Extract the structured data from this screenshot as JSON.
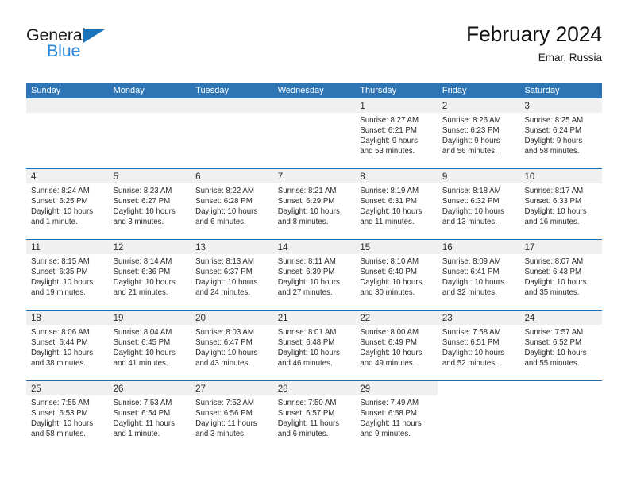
{
  "brand": {
    "name_top": "General",
    "name_bottom": "Blue",
    "accent_color": "#1a74bb",
    "logo_icon": "triangle-icon"
  },
  "header": {
    "title": "February 2024",
    "location": "Emar, Russia"
  },
  "colors": {
    "header_blue": "#2e75b6",
    "row_divider": "#1f6eb5",
    "day_number_bar": "#f0f0f0",
    "text": "#2b2b2b"
  },
  "weekday_headers": [
    "Sunday",
    "Monday",
    "Tuesday",
    "Wednesday",
    "Thursday",
    "Friday",
    "Saturday"
  ],
  "weeks": [
    [
      {
        "day": "",
        "sunrise": "",
        "sunset": "",
        "daylight_line1": "",
        "daylight_line2": "",
        "kind": "empty"
      },
      {
        "day": "",
        "sunrise": "",
        "sunset": "",
        "daylight_line1": "",
        "daylight_line2": "",
        "kind": "empty"
      },
      {
        "day": "",
        "sunrise": "",
        "sunset": "",
        "daylight_line1": "",
        "daylight_line2": "",
        "kind": "empty"
      },
      {
        "day": "",
        "sunrise": "",
        "sunset": "",
        "daylight_line1": "",
        "daylight_line2": "",
        "kind": "empty"
      },
      {
        "day": "1",
        "sunrise": "Sunrise: 8:27 AM",
        "sunset": "Sunset: 6:21 PM",
        "daylight_line1": "Daylight: 9 hours",
        "daylight_line2": "and 53 minutes.",
        "kind": "day"
      },
      {
        "day": "2",
        "sunrise": "Sunrise: 8:26 AM",
        "sunset": "Sunset: 6:23 PM",
        "daylight_line1": "Daylight: 9 hours",
        "daylight_line2": "and 56 minutes.",
        "kind": "day"
      },
      {
        "day": "3",
        "sunrise": "Sunrise: 8:25 AM",
        "sunset": "Sunset: 6:24 PM",
        "daylight_line1": "Daylight: 9 hours",
        "daylight_line2": "and 58 minutes.",
        "kind": "day"
      }
    ],
    [
      {
        "day": "4",
        "sunrise": "Sunrise: 8:24 AM",
        "sunset": "Sunset: 6:25 PM",
        "daylight_line1": "Daylight: 10 hours",
        "daylight_line2": "and 1 minute.",
        "kind": "day"
      },
      {
        "day": "5",
        "sunrise": "Sunrise: 8:23 AM",
        "sunset": "Sunset: 6:27 PM",
        "daylight_line1": "Daylight: 10 hours",
        "daylight_line2": "and 3 minutes.",
        "kind": "day"
      },
      {
        "day": "6",
        "sunrise": "Sunrise: 8:22 AM",
        "sunset": "Sunset: 6:28 PM",
        "daylight_line1": "Daylight: 10 hours",
        "daylight_line2": "and 6 minutes.",
        "kind": "day"
      },
      {
        "day": "7",
        "sunrise": "Sunrise: 8:21 AM",
        "sunset": "Sunset: 6:29 PM",
        "daylight_line1": "Daylight: 10 hours",
        "daylight_line2": "and 8 minutes.",
        "kind": "day"
      },
      {
        "day": "8",
        "sunrise": "Sunrise: 8:19 AM",
        "sunset": "Sunset: 6:31 PM",
        "daylight_line1": "Daylight: 10 hours",
        "daylight_line2": "and 11 minutes.",
        "kind": "day"
      },
      {
        "day": "9",
        "sunrise": "Sunrise: 8:18 AM",
        "sunset": "Sunset: 6:32 PM",
        "daylight_line1": "Daylight: 10 hours",
        "daylight_line2": "and 13 minutes.",
        "kind": "day"
      },
      {
        "day": "10",
        "sunrise": "Sunrise: 8:17 AM",
        "sunset": "Sunset: 6:33 PM",
        "daylight_line1": "Daylight: 10 hours",
        "daylight_line2": "and 16 minutes.",
        "kind": "day"
      }
    ],
    [
      {
        "day": "11",
        "sunrise": "Sunrise: 8:15 AM",
        "sunset": "Sunset: 6:35 PM",
        "daylight_line1": "Daylight: 10 hours",
        "daylight_line2": "and 19 minutes.",
        "kind": "day"
      },
      {
        "day": "12",
        "sunrise": "Sunrise: 8:14 AM",
        "sunset": "Sunset: 6:36 PM",
        "daylight_line1": "Daylight: 10 hours",
        "daylight_line2": "and 21 minutes.",
        "kind": "day"
      },
      {
        "day": "13",
        "sunrise": "Sunrise: 8:13 AM",
        "sunset": "Sunset: 6:37 PM",
        "daylight_line1": "Daylight: 10 hours",
        "daylight_line2": "and 24 minutes.",
        "kind": "day"
      },
      {
        "day": "14",
        "sunrise": "Sunrise: 8:11 AM",
        "sunset": "Sunset: 6:39 PM",
        "daylight_line1": "Daylight: 10 hours",
        "daylight_line2": "and 27 minutes.",
        "kind": "day"
      },
      {
        "day": "15",
        "sunrise": "Sunrise: 8:10 AM",
        "sunset": "Sunset: 6:40 PM",
        "daylight_line1": "Daylight: 10 hours",
        "daylight_line2": "and 30 minutes.",
        "kind": "day"
      },
      {
        "day": "16",
        "sunrise": "Sunrise: 8:09 AM",
        "sunset": "Sunset: 6:41 PM",
        "daylight_line1": "Daylight: 10 hours",
        "daylight_line2": "and 32 minutes.",
        "kind": "day"
      },
      {
        "day": "17",
        "sunrise": "Sunrise: 8:07 AM",
        "sunset": "Sunset: 6:43 PM",
        "daylight_line1": "Daylight: 10 hours",
        "daylight_line2": "and 35 minutes.",
        "kind": "day"
      }
    ],
    [
      {
        "day": "18",
        "sunrise": "Sunrise: 8:06 AM",
        "sunset": "Sunset: 6:44 PM",
        "daylight_line1": "Daylight: 10 hours",
        "daylight_line2": "and 38 minutes.",
        "kind": "day"
      },
      {
        "day": "19",
        "sunrise": "Sunrise: 8:04 AM",
        "sunset": "Sunset: 6:45 PM",
        "daylight_line1": "Daylight: 10 hours",
        "daylight_line2": "and 41 minutes.",
        "kind": "day"
      },
      {
        "day": "20",
        "sunrise": "Sunrise: 8:03 AM",
        "sunset": "Sunset: 6:47 PM",
        "daylight_line1": "Daylight: 10 hours",
        "daylight_line2": "and 43 minutes.",
        "kind": "day"
      },
      {
        "day": "21",
        "sunrise": "Sunrise: 8:01 AM",
        "sunset": "Sunset: 6:48 PM",
        "daylight_line1": "Daylight: 10 hours",
        "daylight_line2": "and 46 minutes.",
        "kind": "day"
      },
      {
        "day": "22",
        "sunrise": "Sunrise: 8:00 AM",
        "sunset": "Sunset: 6:49 PM",
        "daylight_line1": "Daylight: 10 hours",
        "daylight_line2": "and 49 minutes.",
        "kind": "day"
      },
      {
        "day": "23",
        "sunrise": "Sunrise: 7:58 AM",
        "sunset": "Sunset: 6:51 PM",
        "daylight_line1": "Daylight: 10 hours",
        "daylight_line2": "and 52 minutes.",
        "kind": "day"
      },
      {
        "day": "24",
        "sunrise": "Sunrise: 7:57 AM",
        "sunset": "Sunset: 6:52 PM",
        "daylight_line1": "Daylight: 10 hours",
        "daylight_line2": "and 55 minutes.",
        "kind": "day"
      }
    ],
    [
      {
        "day": "25",
        "sunrise": "Sunrise: 7:55 AM",
        "sunset": "Sunset: 6:53 PM",
        "daylight_line1": "Daylight: 10 hours",
        "daylight_line2": "and 58 minutes.",
        "kind": "day"
      },
      {
        "day": "26",
        "sunrise": "Sunrise: 7:53 AM",
        "sunset": "Sunset: 6:54 PM",
        "daylight_line1": "Daylight: 11 hours",
        "daylight_line2": "and 1 minute.",
        "kind": "day"
      },
      {
        "day": "27",
        "sunrise": "Sunrise: 7:52 AM",
        "sunset": "Sunset: 6:56 PM",
        "daylight_line1": "Daylight: 11 hours",
        "daylight_line2": "and 3 minutes.",
        "kind": "day"
      },
      {
        "day": "28",
        "sunrise": "Sunrise: 7:50 AM",
        "sunset": "Sunset: 6:57 PM",
        "daylight_line1": "Daylight: 11 hours",
        "daylight_line2": "and 6 minutes.",
        "kind": "day"
      },
      {
        "day": "29",
        "sunrise": "Sunrise: 7:49 AM",
        "sunset": "Sunset: 6:58 PM",
        "daylight_line1": "Daylight: 11 hours",
        "daylight_line2": "and 9 minutes.",
        "kind": "day"
      },
      {
        "day": "",
        "sunrise": "",
        "sunset": "",
        "daylight_line1": "",
        "daylight_line2": "",
        "kind": "blank"
      },
      {
        "day": "",
        "sunrise": "",
        "sunset": "",
        "daylight_line1": "",
        "daylight_line2": "",
        "kind": "blank"
      }
    ]
  ]
}
